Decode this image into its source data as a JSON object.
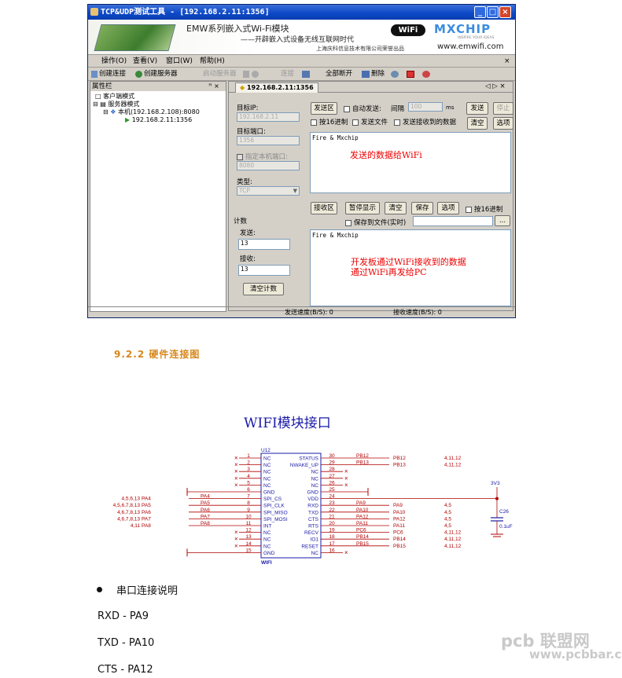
{
  "window": {
    "title": "TCP&UDP测试工具 - [192.168.2.11:1356]",
    "banner": {
      "product": "EMW系列嵌入式Wi-Fi模块",
      "slogan": "——开辟嵌入式设备无线互联网时代",
      "company": "上海庆科信息技术有限公司荣誉出品",
      "wifi_logo": "WiFi",
      "brand": "MXCHIP",
      "brand_tagline": "INSPIRE YOUR IDEAS",
      "url": "www.emwifi.com"
    },
    "menu": [
      "操作(O)",
      "查看(V)",
      "窗口(W)",
      "帮助(H)"
    ],
    "toolbar": [
      "创建连接",
      "创建服务器",
      "启动服务器",
      "连接",
      "全部断开",
      "删除"
    ],
    "left_panel": {
      "title": "属性栏",
      "pin": "ꟸ ×",
      "tree": [
        "客户端模式",
        "服务器模式",
        "本机(192.168.2.108):8080",
        "192.168.2.11:1356"
      ]
    },
    "tab": {
      "label": "192.168.2.11:1356",
      "controls": "◁ ▷ ×"
    },
    "settings": {
      "target_ip_label": "目标IP:",
      "target_ip": "192.168.2.11",
      "target_port_label": "目标端口:",
      "target_port": "1356",
      "local_port_label": "指定本机端口:",
      "local_port": "8080",
      "type_label": "类型:",
      "type_value": "TCP",
      "count_label": "计数",
      "sent_label": "发送:",
      "sent_value": "13",
      "recv_label": "接收:",
      "recv_value": "13",
      "clear_count": "清空计数"
    },
    "send": {
      "area_btn": "发送区",
      "auto_send": "自动发送:",
      "interval_label": "间隔",
      "interval_value": "100",
      "interval_unit": "ms",
      "send_btn": "发送",
      "stop_btn": "停止",
      "hex": "按16进制",
      "send_file": "发送文件",
      "send_recv": "发送接收到的数据",
      "clear_btn": "清空",
      "options_btn": "选项",
      "content": "Fire & Mxchip",
      "note": "发送的数据给WiFi"
    },
    "recv": {
      "area_btn": "接收区",
      "pause_btn": "暂停显示",
      "clear_btn": "清空",
      "save_btn": "保存",
      "options_btn": "选项",
      "hex": "按16进制",
      "save_file": "保存到文件(实时)",
      "browse": "...",
      "content": "Fire & Mxchip",
      "note_line1": "开发板通过WiFi接收到的数据",
      "note_line2": "通过WiFi再发给PC"
    },
    "status": {
      "send_speed": "发送速度(B/S): 0",
      "recv_speed": "接收速度(B/S): 0"
    }
  },
  "section_heading": "9.2.2 硬件连接图",
  "schematic": {
    "title": "WIFI模块接口",
    "ref": "U12",
    "part": "WIFI",
    "left_pins": [
      {
        "num": "1",
        "name": "NC"
      },
      {
        "num": "2",
        "name": "NC"
      },
      {
        "num": "3",
        "name": "NC"
      },
      {
        "num": "4",
        "name": "NC"
      },
      {
        "num": "5",
        "name": "NC"
      },
      {
        "num": "6",
        "name": "GND"
      },
      {
        "num": "7",
        "name": "SPI_CS"
      },
      {
        "num": "8",
        "name": "SPI_CLK"
      },
      {
        "num": "9",
        "name": "SPI_MISO"
      },
      {
        "num": "10",
        "name": "SPI_MOSI"
      },
      {
        "num": "11",
        "name": "INT"
      },
      {
        "num": "12",
        "name": "NC"
      },
      {
        "num": "13",
        "name": "NC"
      },
      {
        "num": "14",
        "name": "NC"
      },
      {
        "num": "15",
        "name": "GND"
      }
    ],
    "right_pins": [
      {
        "num": "30",
        "name": "STATUS"
      },
      {
        "num": "29",
        "name": "NWAKE_UP"
      },
      {
        "num": "28",
        "name": "NC"
      },
      {
        "num": "27",
        "name": "NC"
      },
      {
        "num": "26",
        "name": "NC"
      },
      {
        "num": "25",
        "name": "GND"
      },
      {
        "num": "24",
        "name": "VDD"
      },
      {
        "num": "23",
        "name": "RXD"
      },
      {
        "num": "22",
        "name": "TXD"
      },
      {
        "num": "21",
        "name": "CTS"
      },
      {
        "num": "20",
        "name": "RTS"
      },
      {
        "num": "19",
        "name": "RECV"
      },
      {
        "num": "18",
        "name": "IO1"
      },
      {
        "num": "17",
        "name": "RESET"
      },
      {
        "num": "16",
        "name": "NC"
      }
    ],
    "left_nets": [
      {
        "net": "PA4",
        "refs": "4,5,6,13"
      },
      {
        "net": "PA5",
        "refs": "4,5,6,7,8,13"
      },
      {
        "net": "PA6",
        "refs": "4,6,7,8,13"
      },
      {
        "net": "PA7",
        "refs": "4,6,7,8,13"
      },
      {
        "net": "PA8",
        "refs": "4,11"
      }
    ],
    "right_nets": [
      {
        "net": "PB12",
        "refs": "4,11,12"
      },
      {
        "net": "PB13",
        "refs": "4,11,12"
      },
      {
        "net": "PA9",
        "refs": "4,5"
      },
      {
        "net": "PA10",
        "refs": "4,5"
      },
      {
        "net": "PA12",
        "refs": "4,5"
      },
      {
        "net": "PA11",
        "refs": "4,5"
      },
      {
        "net": "PC6",
        "refs": "4,11,12"
      },
      {
        "net": "PB14",
        "refs": "4,11,12"
      },
      {
        "net": "PB15",
        "refs": "4,11,12"
      }
    ],
    "cap": {
      "ref": "C26",
      "value": "0.1uF",
      "rail": "3V3"
    }
  },
  "bullet": "串口连接说明",
  "mappings": [
    "RXD - PA9",
    "TXD - PA10",
    "CTS - PA12"
  ],
  "watermark": {
    "main": "pcb 联盟网",
    "url": "www.pcbbar.com"
  }
}
